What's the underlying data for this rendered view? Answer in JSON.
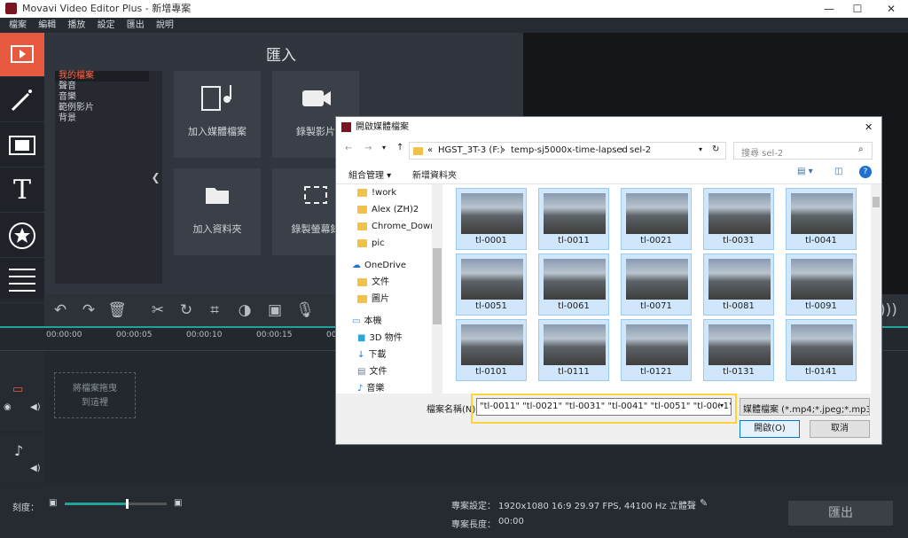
{
  "window": {
    "title": "Movavi Video Editor Plus - 新增專案",
    "min": "—",
    "max": "☐",
    "close": "✕"
  },
  "menu": [
    "檔案",
    "編輯",
    "播放",
    "設定",
    "匯出",
    "說明"
  ],
  "import": {
    "title": "匯入",
    "categories": [
      "我的檔案",
      "聲音",
      "音樂",
      "範例影片",
      "背景"
    ],
    "tiles": [
      "加入媒體檔案",
      "錄製影片",
      "加入資料夾",
      "錄製螢幕錄"
    ]
  },
  "timeline": {
    "ruler": [
      "00:00:00",
      "00:00:05",
      "00:00:10",
      "00:00:15",
      "00:00:2"
    ],
    "dropzone": [
      "將檔案拖曳",
      "到這裡"
    ]
  },
  "bottom": {
    "zoom_label": "刻度：",
    "zoom_value": 0.6,
    "settings_label": "專案設定：",
    "settings_value": "1920x1080 16:9 29.97 FPS, 44100 Hz 立體聲",
    "length_label": "專案長度：",
    "length_value": "00:00",
    "export_button": "匯出"
  },
  "dialog": {
    "title": "開啟媒體檔案",
    "close": "✕",
    "path": [
      "«",
      "HGST_3T-3 (F:)",
      "›",
      "temp-sj5000x-time-lapsed",
      "›",
      "sel-2"
    ],
    "search_placeholder": "搜尋 sel-2",
    "organize": "組合管理 ▾",
    "new_folder": "新增資料夾",
    "nav": {
      "items": [
        "!work",
        "Alex (ZH)2",
        "Chrome_Downl",
        "pic"
      ],
      "onedrive": "OneDrive",
      "od_items": [
        "文件",
        "圖片"
      ],
      "pc": "本機",
      "pc_items": [
        "3D 物件",
        "下載",
        "文件",
        "音樂"
      ]
    },
    "files": [
      "tl-0001",
      "tl-0011",
      "tl-0021",
      "tl-0031",
      "tl-0041",
      "tl-0051",
      "tl-0061",
      "tl-0071",
      "tl-0081",
      "tl-0091",
      "tl-0101",
      "tl-0111",
      "tl-0121",
      "tl-0131",
      "tl-0141"
    ],
    "filename_label": "檔案名稱(N):",
    "filename_value": "\"tl-0011\" \"tl-0021\" \"tl-0031\" \"tl-0041\" \"tl-0051\" \"tl-0061\" \"tl-0",
    "filetype": "媒體檔案 (*.mp4;*.jpeg;*.mp3",
    "open": "開啟(O)",
    "cancel": "取消"
  }
}
